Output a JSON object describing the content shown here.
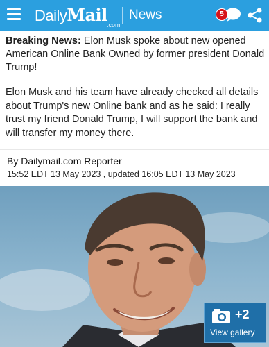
{
  "header": {
    "logo_daily": "Daily",
    "logo_mail": "Mail",
    "logo_com": ".com",
    "section": "News",
    "notification_count": "5"
  },
  "article": {
    "breaking_label": "Breaking News:",
    "breaking_text": "Elon Musk spoke about new opened American Online Bank Owned by former president Donald Trump!",
    "body": "Elon Musk and his team have already checked all details about Trump's new Online bank and as he said: I really trust my friend Donald Trump, I will support the bank and will transfer my money there.",
    "byline": "By Dailymail.com Reporter",
    "dateline": "15:52 EDT 13 May 2023 , updated 16:05 EDT 13 May 2023"
  },
  "gallery": {
    "count": "+2",
    "label": "View gallery"
  },
  "colors": {
    "brand_blue": "#2b9fdf",
    "notification_red": "#d7141a"
  }
}
